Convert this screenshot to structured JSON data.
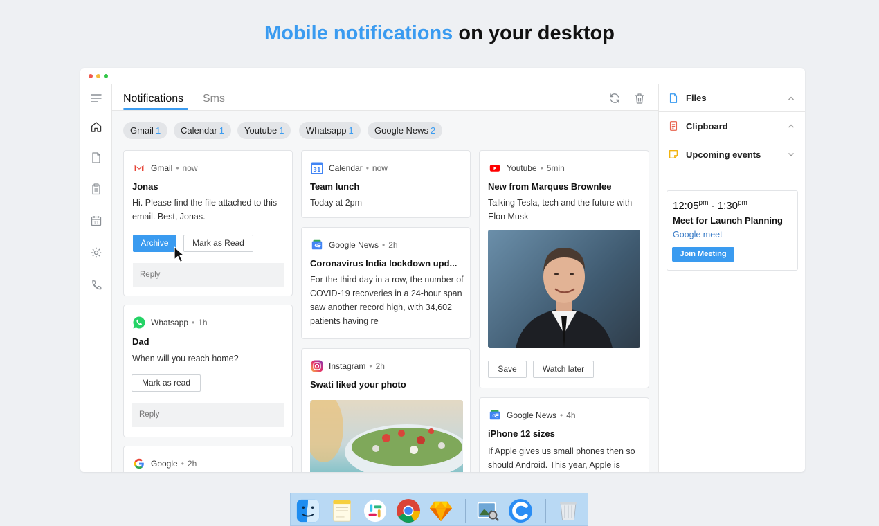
{
  "headline": {
    "accent": "Mobile notifications",
    "rest": " on your desktop"
  },
  "tabs": {
    "notifications": "Notifications",
    "sms": "Sms"
  },
  "filters": [
    {
      "label": "Gmail",
      "count": "1"
    },
    {
      "label": "Calendar",
      "count": "1"
    },
    {
      "label": "Youtube",
      "count": "1"
    },
    {
      "label": "Whatsapp",
      "count": "1"
    },
    {
      "label": "Google News",
      "count": "2"
    }
  ],
  "cards": {
    "gmail": {
      "app": "Gmail",
      "time": "now",
      "title": "Jonas",
      "body": "Hi. Please find the file attached to this email. Best, Jonas.",
      "archive": "Archive",
      "mark": "Mark as Read",
      "reply": "Reply"
    },
    "whatsapp": {
      "app": "Whatsapp",
      "time": "1h",
      "title": "Dad",
      "body": "When will you reach home?",
      "mark": "Mark as read",
      "reply": "Reply"
    },
    "google": {
      "app": "Google",
      "time": "2h"
    },
    "calendar": {
      "app": "Calendar",
      "time": "now",
      "title": "Team lunch",
      "body": "Today at 2pm",
      "icon_day": "31"
    },
    "gnews1": {
      "app": "Google News",
      "time": "2h",
      "title": "Coronavirus India lockdown upd...",
      "body": "For the third day in a row, the number of COVID-19 recoveries in a 24-hour span saw another record high, with 34,602 patients having re"
    },
    "instagram": {
      "app": "Instagram",
      "time": "2h",
      "title": "Swati liked your photo"
    },
    "youtube": {
      "app": "Youtube",
      "time": "5min",
      "title": "New from Marques Brownlee",
      "body": "Talking Tesla, tech and the future with Elon Musk",
      "save": "Save",
      "watch": "Watch later"
    },
    "gnews2": {
      "app": "Google News",
      "time": "4h",
      "title": "iPhone 12 sizes",
      "body": "If Apple gives us small phones then so should Android. This year, Apple is"
    }
  },
  "side": {
    "files": "Files",
    "clipboard": "Clipboard",
    "events": "Upcoming events",
    "event": {
      "start": "12:05",
      "start_suffix": "pm",
      "dash": " - ",
      "end": "1:30",
      "end_suffix": "pm",
      "title": "Meet for Launch Planning",
      "sub": "Google meet",
      "join": "Join Meeting"
    }
  },
  "colors": {
    "accent": "#3a9bf0",
    "window_bg": "#ffffff",
    "page_bg": "#eef0f3"
  },
  "icons": {
    "rail": [
      "menu-icon",
      "home-icon",
      "file-icon",
      "clipboard-icon",
      "calendar-icon",
      "gear-icon",
      "phone-icon"
    ],
    "toolbar": [
      "refresh-icon",
      "trash-icon"
    ],
    "dock": [
      "finder-icon",
      "notes-icon",
      "slack-icon",
      "chrome-icon",
      "sketch-icon",
      "preview-icon",
      "app-c-icon",
      "trash-bin-icon"
    ]
  }
}
